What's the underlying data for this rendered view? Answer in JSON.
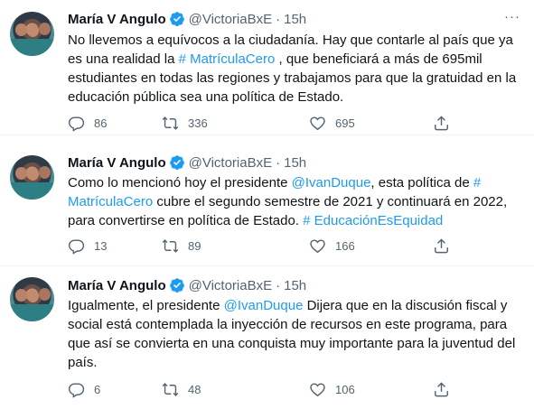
{
  "tweets": [
    {
      "author_name": "María V Angulo",
      "handle": "@VictoriaBxE",
      "separator": "·",
      "time": "15h",
      "more": "···",
      "text_parts": [
        "No llevemos a equívocos a la ciudadanía. Hay que contarle al país que ya es una realidad la ",
        "# MatrículaCero",
        " , que beneficiará a más de 695mil estudiantes en todas las regiones y trabajamos para que la gratuidad en la educación pública sea una política de Estado."
      ],
      "replies": "86",
      "retweets": "336",
      "likes": "695"
    },
    {
      "author_name": "María V Angulo",
      "handle": "@VictoriaBxE",
      "separator": "·",
      "time": "15h",
      "more": "···",
      "text_parts": [
        "Como lo mencionó hoy el presidente ",
        "@IvanDuque",
        ", esta política de ",
        "# MatrículaCero",
        " cubre el segundo semestre de 2021 y continuará en 2022, para convertirse en política de Estado. ",
        "# EducaciónEsEquidad"
      ],
      "replies": "13",
      "retweets": "89",
      "likes": "166"
    },
    {
      "author_name": "María V Angulo",
      "handle": "@VictoriaBxE",
      "separator": "·",
      "time": "15h",
      "more": "···",
      "text_parts": [
        "Igualmente, el presidente ",
        "@IvanDuque",
        " Dijera que en la discusión fiscal y social está contemplada la inyección de recursos en este programa, para que así se convierta en una conquista muy importante para la juventud del país."
      ],
      "replies": "6",
      "retweets": "48",
      "likes": "106"
    }
  ],
  "colors": {
    "link": "#1d9bf0",
    "verified": "#1d9bf0",
    "muted": "#536471",
    "text": "#0f1419"
  },
  "icons": [
    "verified-badge-icon",
    "reply-icon",
    "retweet-icon",
    "like-icon",
    "share-icon",
    "more-icon"
  ]
}
